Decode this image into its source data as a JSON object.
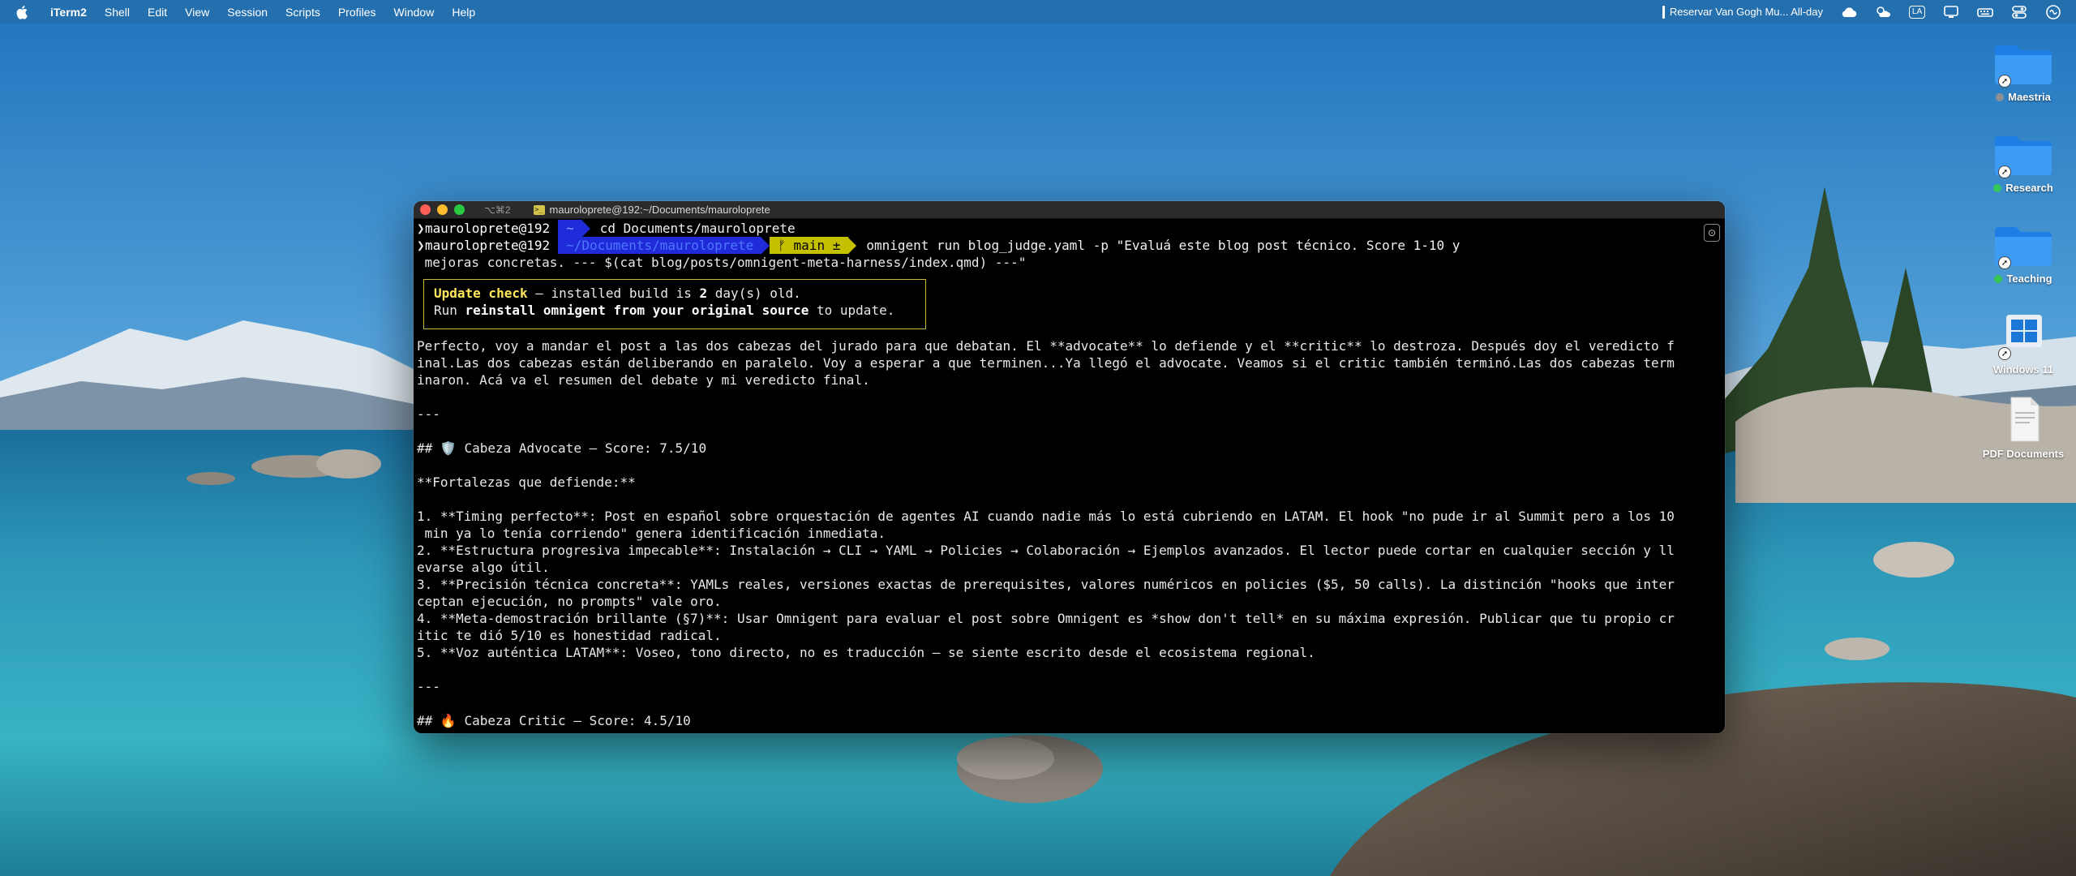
{
  "menubar": {
    "app_name": "iTerm2",
    "items": [
      "Shell",
      "Edit",
      "View",
      "Session",
      "Scripts",
      "Profiles",
      "Window",
      "Help"
    ],
    "calendar_event": "Reservar Van Gogh Mu... All-day",
    "input_source": "LA"
  },
  "desktop": {
    "icons": [
      {
        "label": "Maestria",
        "tag_color": "#8e8e93"
      },
      {
        "label": "Research",
        "tag_color": "#34c759"
      },
      {
        "label": "Teaching",
        "tag_color": "#34c759"
      },
      {
        "label": "Windows 11"
      },
      {
        "label": "PDF Documents"
      }
    ]
  },
  "terminal": {
    "shortcut": "⌥⌘2",
    "title": "mauroloprete@192:~/Documents/mauroloprete",
    "prompt1": {
      "user": "mauroloprete@192",
      "dir": "~",
      "command": "cd Documents/mauroloprete"
    },
    "prompt2": {
      "user": "mauroloprete@192",
      "dir": "~/Documents/mauroloprete",
      "git": "ᚠ main ±",
      "command": "omnigent run blog_judge.yaml -p \"Evaluá este blog post técnico. Score 1-10 y",
      "command_cont": " mejoras concretas. --- $(cat blog/posts/omnigent-meta-harness/index.qmd) ---\""
    },
    "update": {
      "label": "Update check",
      "text1": " — installed build is ",
      "days": "2",
      "text2": " day(s) old.",
      "run": "Run ",
      "command": "reinstall omnigent from your original source",
      "text3": " to update."
    },
    "lines": [
      "Perfecto, voy a mandar el post a las dos cabezas del jurado para que debatan. El **advocate** lo defiende y el **critic** lo destroza. Después doy el veredicto f",
      "inal.Las dos cabezas están deliberando en paralelo. Voy a esperar a que terminen...Ya llegó el advocate. Veamos si el critic también terminó.Las dos cabezas term",
      "inaron. Acá va el resumen del debate y mi veredicto final.",
      "",
      "---",
      "",
      "## 🛡️ Cabeza Advocate — Score: 7.5/10",
      "",
      "**Fortalezas que defiende:**",
      "",
      "1. **Timing perfecto**: Post en español sobre orquestación de agentes AI cuando nadie más lo está cubriendo en LATAM. El hook \"no pude ir al Summit pero a los 10",
      " min ya lo tenía corriendo\" genera identificación inmediata.",
      "2. **Estructura progresiva impecable**: Instalación → CLI → YAML → Policies → Colaboración → Ejemplos avanzados. El lector puede cortar en cualquier sección y ll",
      "evarse algo útil.",
      "3. **Precisión técnica concreta**: YAMLs reales, versiones exactas de prerequisites, valores numéricos en policies ($5, 50 calls). La distinción \"hooks que inter",
      "ceptan ejecución, no prompts\" vale oro.",
      "4. **Meta-demostración brillante (§7)**: Usar Omnigent para evaluar el post sobre Omnigent es *show don't tell* en su máxima expresión. Publicar que tu propio cr",
      "itic te dió 5/10 es honestidad radical.",
      "5. **Voz auténtica LATAM**: Voseo, tono directo, no es traducción — se siente escrito desde el ecosistema regional.",
      "",
      "---",
      "",
      "## 🔥 Cabeza Critic — Score: 4.5/10"
    ]
  }
}
